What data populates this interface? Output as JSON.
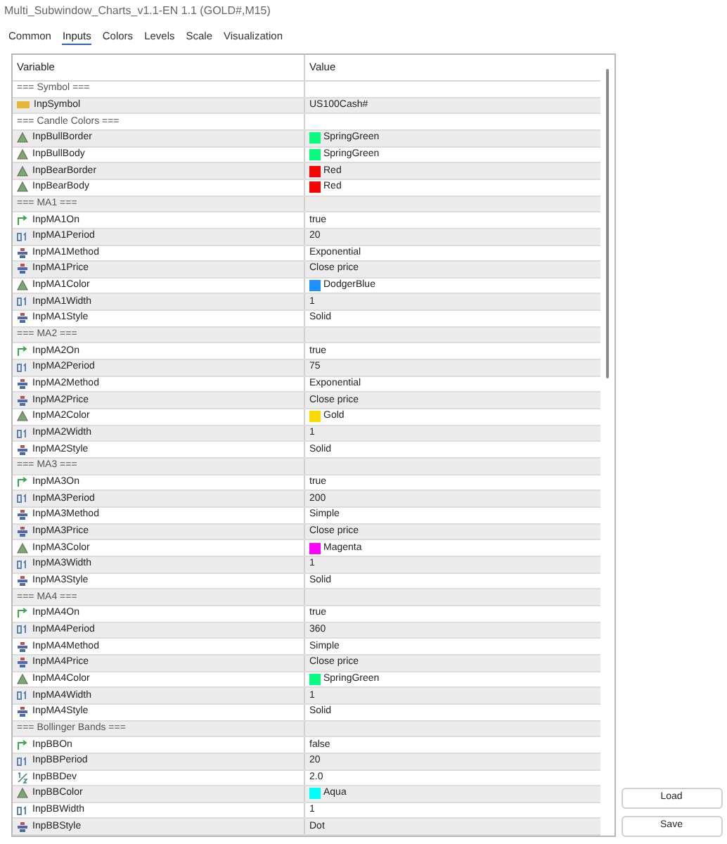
{
  "window": {
    "title": "Multi_Subwindow_Charts_v1.1-EN 1.1 (GOLD#,M15)"
  },
  "tabs": [
    {
      "label": "Common",
      "selected": false
    },
    {
      "label": "Inputs",
      "selected": true
    },
    {
      "label": "Colors",
      "selected": false
    },
    {
      "label": "Levels",
      "selected": false
    },
    {
      "label": "Scale",
      "selected": false
    },
    {
      "label": "Visualization",
      "selected": false
    }
  ],
  "table": {
    "columns": [
      "Variable",
      "Value"
    ],
    "rows": [
      {
        "kind": "section",
        "variable": "=== Symbol ==="
      },
      {
        "kind": "string",
        "variable": "InpSymbol",
        "value": "US100Cash#"
      },
      {
        "kind": "section",
        "variable": "=== Candle Colors ==="
      },
      {
        "kind": "color",
        "variable": "InpBullBorder",
        "value": "SpringGreen",
        "color": "#00ff7f"
      },
      {
        "kind": "color",
        "variable": "InpBullBody",
        "value": "SpringGreen",
        "color": "#00ff7f"
      },
      {
        "kind": "color",
        "variable": "InpBearBorder",
        "value": "Red",
        "color": "#ff0000"
      },
      {
        "kind": "color",
        "variable": "InpBearBody",
        "value": "Red",
        "color": "#ff0000"
      },
      {
        "kind": "section",
        "variable": "=== MA1 ==="
      },
      {
        "kind": "bool",
        "variable": "InpMA1On",
        "value": "true"
      },
      {
        "kind": "int",
        "variable": "InpMA1Period",
        "value": "20"
      },
      {
        "kind": "enum",
        "variable": "InpMA1Method",
        "value": "Exponential"
      },
      {
        "kind": "enum",
        "variable": "InpMA1Price",
        "value": "Close price"
      },
      {
        "kind": "color",
        "variable": "InpMA1Color",
        "value": "DodgerBlue",
        "color": "#1e90ff"
      },
      {
        "kind": "int",
        "variable": "InpMA1Width",
        "value": "1"
      },
      {
        "kind": "enum",
        "variable": "InpMA1Style",
        "value": "Solid"
      },
      {
        "kind": "section",
        "variable": "=== MA2 ==="
      },
      {
        "kind": "bool",
        "variable": "InpMA2On",
        "value": "true"
      },
      {
        "kind": "int",
        "variable": "InpMA2Period",
        "value": "75"
      },
      {
        "kind": "enum",
        "variable": "InpMA2Method",
        "value": "Exponential"
      },
      {
        "kind": "enum",
        "variable": "InpMA2Price",
        "value": "Close price"
      },
      {
        "kind": "color",
        "variable": "InpMA2Color",
        "value": "Gold",
        "color": "#ffd700"
      },
      {
        "kind": "int",
        "variable": "InpMA2Width",
        "value": "1"
      },
      {
        "kind": "enum",
        "variable": "InpMA2Style",
        "value": "Solid"
      },
      {
        "kind": "section",
        "variable": "=== MA3 ==="
      },
      {
        "kind": "bool",
        "variable": "InpMA3On",
        "value": "true"
      },
      {
        "kind": "int",
        "variable": "InpMA3Period",
        "value": "200"
      },
      {
        "kind": "enum",
        "variable": "InpMA3Method",
        "value": "Simple"
      },
      {
        "kind": "enum",
        "variable": "InpMA3Price",
        "value": "Close price"
      },
      {
        "kind": "color",
        "variable": "InpMA3Color",
        "value": "Magenta",
        "color": "#ff00ff"
      },
      {
        "kind": "int",
        "variable": "InpMA3Width",
        "value": "1"
      },
      {
        "kind": "enum",
        "variable": "InpMA3Style",
        "value": "Solid"
      },
      {
        "kind": "section",
        "variable": "=== MA4 ==="
      },
      {
        "kind": "bool",
        "variable": "InpMA4On",
        "value": "true"
      },
      {
        "kind": "int",
        "variable": "InpMA4Period",
        "value": "360"
      },
      {
        "kind": "enum",
        "variable": "InpMA4Method",
        "value": "Simple"
      },
      {
        "kind": "enum",
        "variable": "InpMA4Price",
        "value": "Close price"
      },
      {
        "kind": "color",
        "variable": "InpMA4Color",
        "value": "SpringGreen",
        "color": "#00ff7f"
      },
      {
        "kind": "int",
        "variable": "InpMA4Width",
        "value": "1"
      },
      {
        "kind": "enum",
        "variable": "InpMA4Style",
        "value": "Solid"
      },
      {
        "kind": "section",
        "variable": "=== Bollinger Bands ==="
      },
      {
        "kind": "bool",
        "variable": "InpBBOn",
        "value": "false"
      },
      {
        "kind": "int",
        "variable": "InpBBPeriod",
        "value": "20"
      },
      {
        "kind": "double",
        "variable": "InpBBDev",
        "value": "2.0"
      },
      {
        "kind": "color",
        "variable": "InpBBColor",
        "value": "Aqua",
        "color": "#00ffff"
      },
      {
        "kind": "int",
        "variable": "InpBBWidth",
        "value": "1"
      },
      {
        "kind": "enum",
        "variable": "InpBBStyle",
        "value": "Dot"
      }
    ]
  },
  "buttons": [
    {
      "label": "Load"
    },
    {
      "label": "Save"
    }
  ]
}
